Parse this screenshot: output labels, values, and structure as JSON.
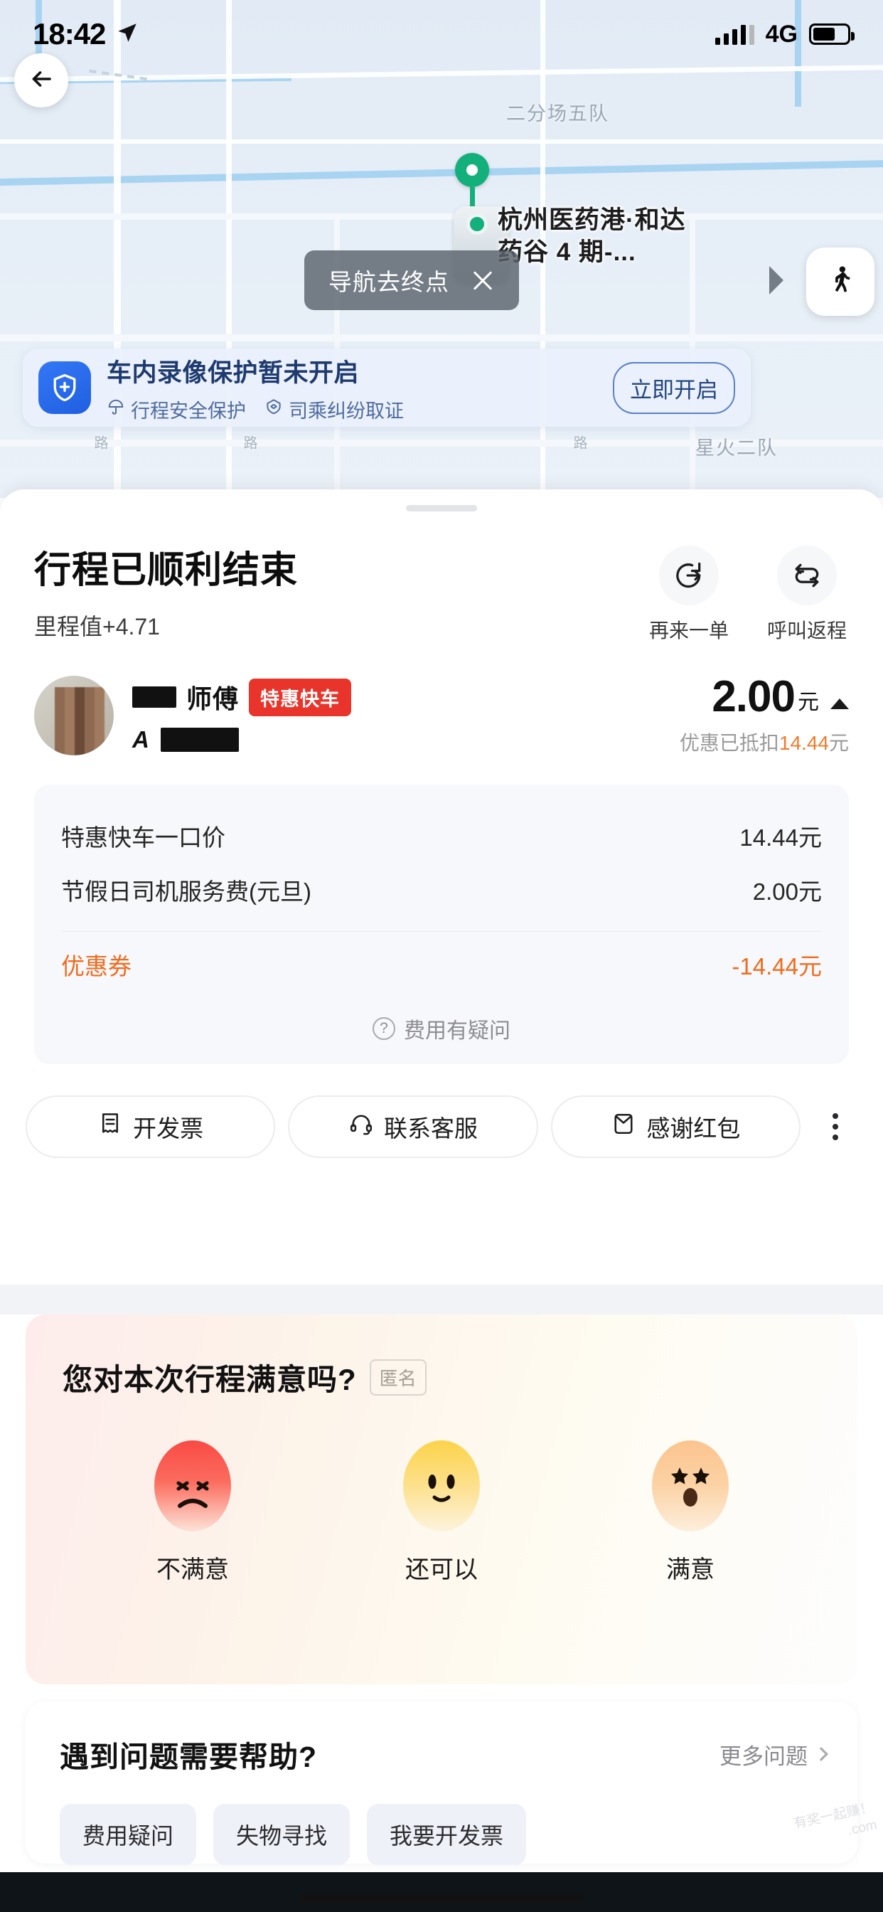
{
  "status_bar": {
    "time": "18:42",
    "network": "4G",
    "location_icon": "location-arrow-icon",
    "signal_icon": "signal-bars-icon",
    "battery_icon": "battery-icon"
  },
  "map": {
    "back_icon": "back-arrow-icon",
    "walk_icon": "walking-person-icon",
    "area_label": "二分场五队",
    "road_labels": [
      "路",
      "路",
      "路"
    ],
    "bottom_label": "星火二队",
    "destination": "杭州医药港·和达药谷 4 期-...",
    "nav_tip": {
      "label": "导航去终点",
      "close_icon": "close-icon"
    },
    "pin_color": "#14b07b"
  },
  "safety_banner": {
    "icon": "shield-plus-icon",
    "title": "车内录像保护暂未开启",
    "features": [
      {
        "icon": "umbrella-icon",
        "label": "行程安全保护"
      },
      {
        "icon": "handshake-icon",
        "label": "司乘纠纷取证"
      }
    ],
    "action_label": "立即开启",
    "accent": "#3478f6"
  },
  "trip_summary": {
    "title": "行程已顺利结束",
    "subtitle": "里程值+4.71",
    "actions": [
      {
        "icon": "reorder-icon",
        "label": "再来一单"
      },
      {
        "icon": "return-trip-icon",
        "label": "呼叫返程"
      }
    ]
  },
  "driver": {
    "avatar": "driver-avatar-mosaic",
    "name_suffix": "师傅",
    "name_redacted": true,
    "plate_prefix": "A",
    "plate_redacted": true,
    "car_type_badge": "特惠快车",
    "badge_color": "#e8342a"
  },
  "price": {
    "amount": "2.00",
    "unit": "元",
    "expand_icon": "caret-up-icon",
    "discount_note_prefix": "优惠已抵扣",
    "discount_amount": "14.44",
    "discount_note_suffix": "元",
    "discount_color": "#f07b2a"
  },
  "fare_detail": {
    "rows": [
      {
        "label": "特惠快车一口价",
        "value": "14.44元"
      },
      {
        "label": "节假日司机服务费(元旦)",
        "value": "2.00元"
      }
    ],
    "coupon": {
      "label": "优惠券",
      "value": "-14.44元",
      "color": "#ef6c1e"
    },
    "help": {
      "icon": "question-circle-icon",
      "label": "费用有疑问"
    }
  },
  "action_buttons": [
    {
      "icon": "invoice-icon",
      "label": "开发票"
    },
    {
      "icon": "headset-icon",
      "label": "联系客服"
    },
    {
      "icon": "red-packet-icon",
      "label": "感谢红包"
    }
  ],
  "more_button": {
    "icon": "more-vertical-icon"
  },
  "rating": {
    "title": "您对本次行程满意吗?",
    "anonymous_badge": "匿名",
    "options": [
      {
        "icon": "angry-face-icon",
        "label": "不满意"
      },
      {
        "icon": "neutral-face-icon",
        "label": "还可以"
      },
      {
        "icon": "star-eyes-face-icon",
        "label": "满意"
      }
    ]
  },
  "help": {
    "title": "遇到问题需要帮助?",
    "more_label": "更多问题",
    "more_icon": "chevron-right-icon",
    "chips": [
      "费用疑问",
      "失物寻找",
      "我要开发票"
    ]
  },
  "watermark": "有奖一起赚！\n.com"
}
